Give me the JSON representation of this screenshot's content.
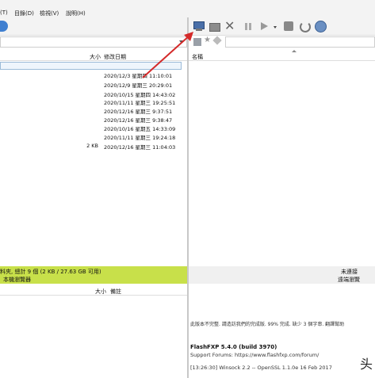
{
  "menu": {
    "items": [
      "(T)",
      "目錄(D)",
      "檢視(V)",
      "說明(H)"
    ]
  },
  "left_panel": {
    "columns": {
      "size": "大小",
      "date": "修改日期"
    },
    "rows": [
      {
        "size": "",
        "date": "2020/12/3 星期四 11:10:01"
      },
      {
        "size": "",
        "date": "2020/12/9 星期三 20:29:01"
      },
      {
        "size": "",
        "date": "2020/10/15 星期四 14:43:02"
      },
      {
        "size": "",
        "date": "2020/11/11 星期三 19:25:51"
      },
      {
        "size": "",
        "date": "2020/12/16 星期三 9:37:51"
      },
      {
        "size": "",
        "date": "2020/12/16 星期三 9:38:47"
      },
      {
        "size": "",
        "date": "2020/10/16 星期五 14:33:09"
      },
      {
        "size": "",
        "date": "2020/11/11 星期三 19:24:18"
      },
      {
        "size": "2 KB",
        "date": "2020/12/16 星期三 11:04:03"
      }
    ],
    "status": "料夾, 總計 9 個 (2 KB / 27.63 GB 可用)",
    "status2": "本機瀏覽器",
    "queue_columns": {
      "size": "大小",
      "note": "備註"
    }
  },
  "right_panel": {
    "columns": {
      "name": "名稱"
    },
    "status": "未連接",
    "status2": "遠端瀏覽",
    "log": {
      "notice": "此版本不完整. 請造訪我們的完成版. 99% 完成. 缺少 3 個字串. 翻譯幫助",
      "app": "FlashFXP 5.4.0 (build 3970)",
      "support": "Support Forums: https://www.flashfxp.com/forum/",
      "winsock": "[13:26:30] Winsock 2.2 -- OpenSSL 1.1.0e  16 Feb 2017"
    }
  },
  "watermark": "头"
}
